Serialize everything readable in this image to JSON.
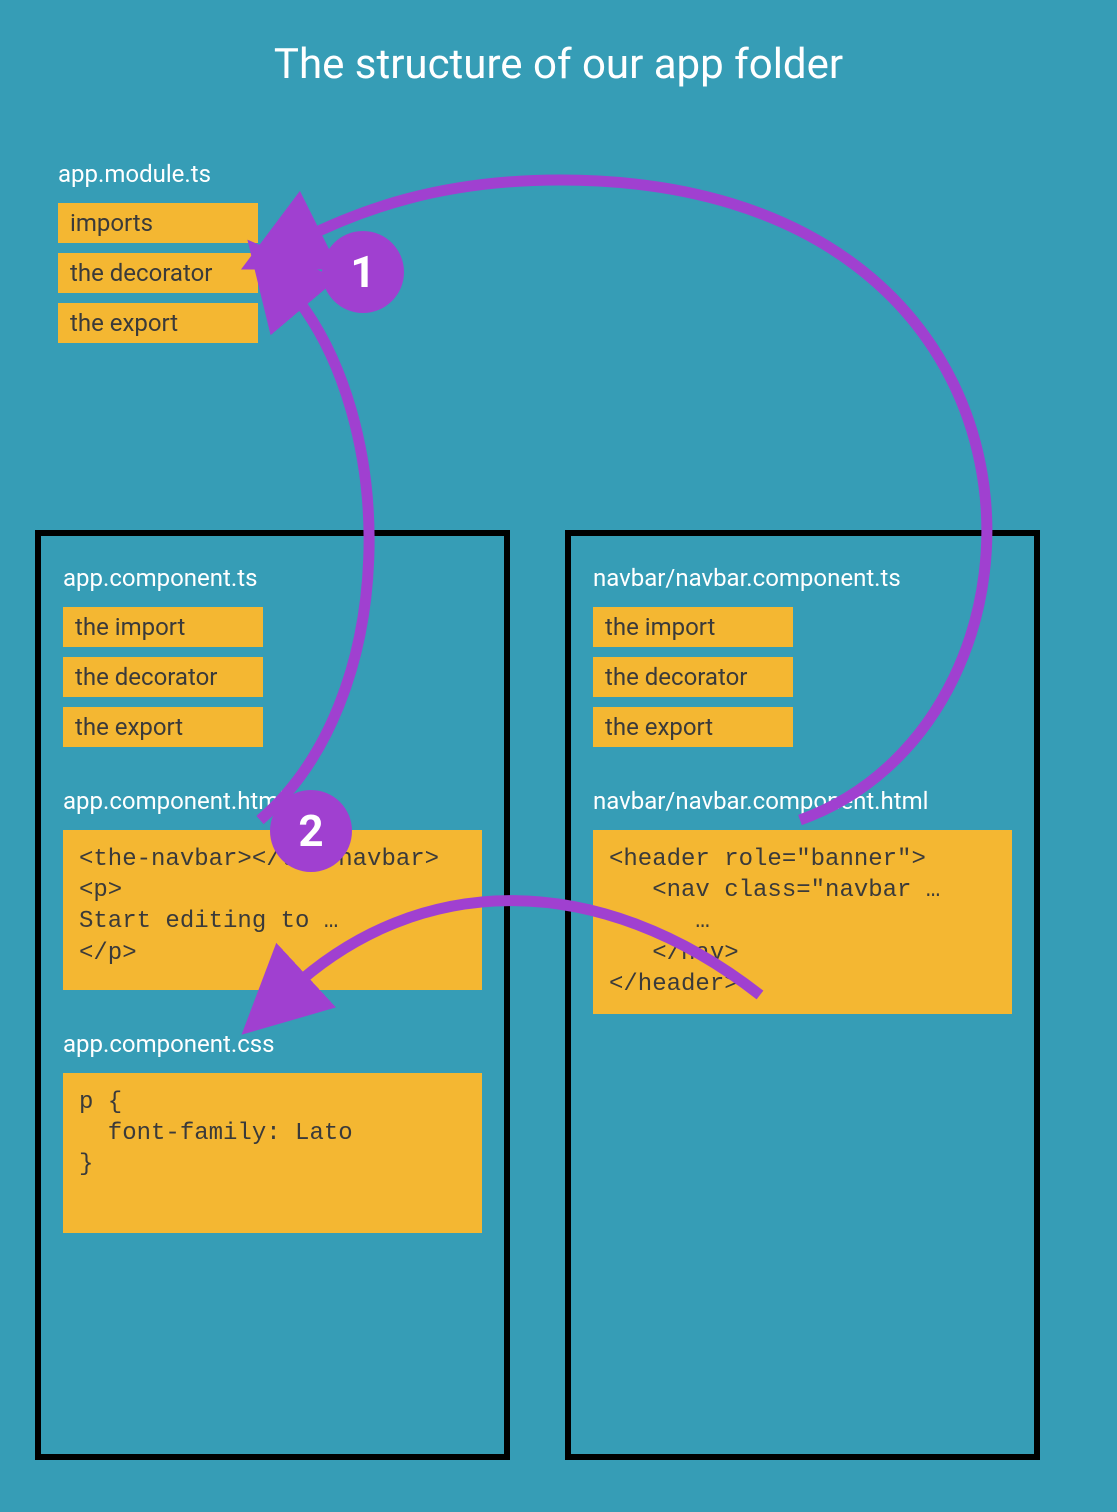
{
  "title": "The structure of our app folder",
  "module": {
    "filename": "app.module.ts",
    "parts": [
      "imports",
      "the decorator",
      "the export"
    ]
  },
  "left": {
    "ts": {
      "filename": "app.component.ts",
      "parts": [
        "the import",
        "the decorator",
        "the export"
      ]
    },
    "html": {
      "filename": "app.component.html",
      "code": "<the-navbar></the-navbar>\n<p>\nStart editing to …\n</p>"
    },
    "css": {
      "filename": "app.component.css",
      "code": "p {\n  font-family: Lato\n}"
    }
  },
  "right": {
    "ts": {
      "filename": "navbar/navbar.component.ts",
      "parts": [
        "the import",
        "the decorator",
        "the export"
      ]
    },
    "html": {
      "filename": "navbar/navbar.component.html",
      "code": "<header role=\"banner\">\n   <nav class=\"navbar …\n      …\n   </nav>\n</header>"
    }
  },
  "badges": {
    "one": "1",
    "two": "2"
  },
  "colors": {
    "bg": "#369db6",
    "chip": "#f4b732",
    "badge": "#a040d0",
    "arrow": "#a040d0"
  }
}
